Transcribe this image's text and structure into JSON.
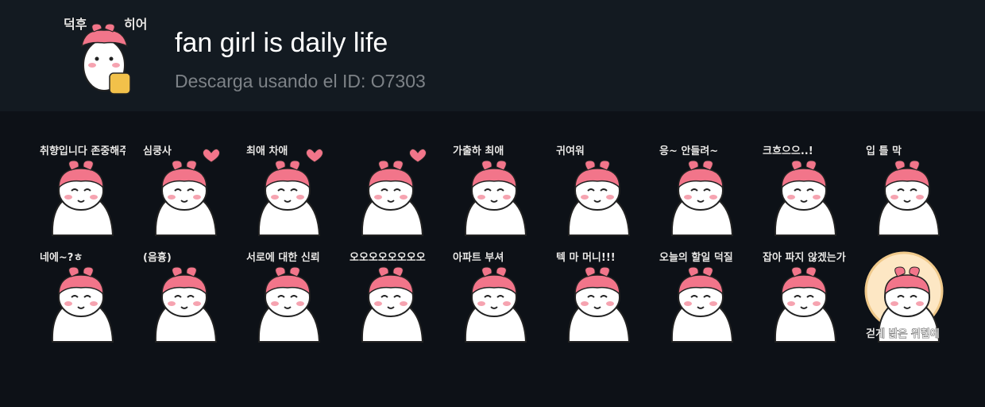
{
  "pack": {
    "title": "fan girl is daily life",
    "subtitle": "Descarga usando el ID: O7303",
    "icon_text_left": "덕후",
    "icon_text_right": "히어"
  },
  "stickers": [
    {
      "name": "sticker-respect-taste",
      "caption": "취향입니다 존중해주쎔"
    },
    {
      "name": "sticker-heart-attack",
      "caption": "심쿵사"
    },
    {
      "name": "sticker-bias-hearts",
      "caption": "최애 차애"
    },
    {
      "name": "sticker-thumbs-hearts",
      "caption": ""
    },
    {
      "name": "sticker-sun-bias",
      "caption": "가출하 최애"
    },
    {
      "name": "sticker-cute",
      "caption": "귀여워"
    },
    {
      "name": "sticker-headphones",
      "caption": "응~ 안들려~"
    },
    {
      "name": "sticker-kuhuu",
      "caption": "크흐으으..!"
    },
    {
      "name": "sticker-cover-mouth",
      "caption": "입 틀 막"
    },
    {
      "name": "sticker-naeo",
      "caption": "네에~?ㅎ"
    },
    {
      "name": "sticker-eumheung",
      "caption": "(음흉)"
    },
    {
      "name": "sticker-theory",
      "caption": "서로에 대한 신뢰"
    },
    {
      "name": "sticker-ooo",
      "caption": "오오오오오오오오"
    },
    {
      "name": "sticker-apartment",
      "caption": "아파트 부셔"
    },
    {
      "name": "sticker-money",
      "caption": "텍 마 머니!!!"
    },
    {
      "name": "sticker-notebook",
      "caption": "오늘의 할일 덕질"
    },
    {
      "name": "sticker-phone",
      "caption": "잡아 파지 않겠는가"
    },
    {
      "name": "sticker-badge",
      "caption": "걷게 밝은 위험에"
    }
  ],
  "colors": {
    "background": "#0d1117",
    "header": "#131a21",
    "hair": "#f2758a",
    "skin": "#ffffff",
    "title": "#ffffff",
    "subtitle": "#7d8287"
  }
}
